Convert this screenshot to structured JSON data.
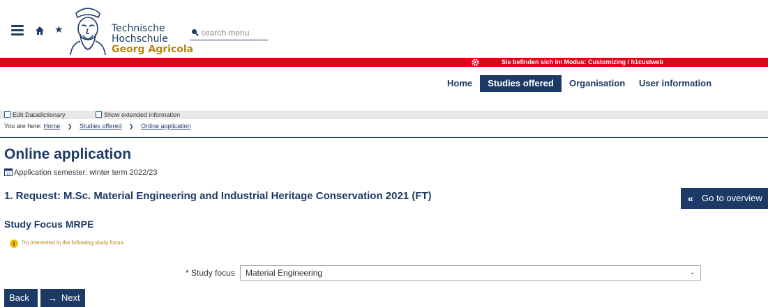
{
  "header": {
    "brand_line1": "Technische",
    "brand_line2": "Hochschule",
    "brand_line3": "Georg Agricola",
    "search_placeholder": "search menu",
    "icons": [
      "menu-icon",
      "home-icon",
      "star-icon",
      "search-icon",
      "university-logo"
    ]
  },
  "mode_bar": {
    "text": "Sie befinden sich im Modus: Customizing / h1custweb",
    "color": "#e2001a",
    "icon": "gear-icon"
  },
  "nav": {
    "items": [
      {
        "label": "Home",
        "active": false
      },
      {
        "label": "Studies offered",
        "active": true
      },
      {
        "label": "Organisation",
        "active": false
      },
      {
        "label": "User information",
        "active": false
      }
    ],
    "accent_color": "#1d3a67"
  },
  "toolbar": {
    "edit_label": "Edit Datadictionary",
    "extended_label": "Show extended information"
  },
  "breadcrumb": {
    "prefix": "You are here:",
    "items": [
      "Home",
      "Studies offered",
      "Online application"
    ]
  },
  "main": {
    "title": "Online application",
    "semester": "Application semester: winter term 2022/23",
    "request": "1. Request: M.Sc. Material Engineering and Industrial Heritage Conservation 2021 (FT)",
    "overview_button": "Go to overview",
    "focus_title": "Study Focus MRPE",
    "hint": "I'm interested in the following study focus:",
    "field_label": "* Study focus",
    "field_value": "Material Engineering",
    "back_button": "Back",
    "next_button": "Next"
  }
}
